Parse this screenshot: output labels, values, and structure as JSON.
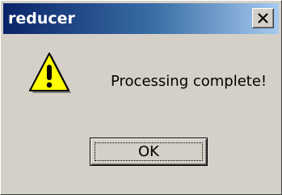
{
  "window": {
    "title": "reducer",
    "close_icon": "close-icon"
  },
  "content": {
    "icon": "warning-icon",
    "message": "Processing complete!"
  },
  "buttons": {
    "ok_label": "OK"
  },
  "colors": {
    "dialog_face": "#d4d0c8",
    "titlebar_start": "#0a246a",
    "titlebar_end": "#a6caf0",
    "warning_fill": "#ffff00"
  }
}
